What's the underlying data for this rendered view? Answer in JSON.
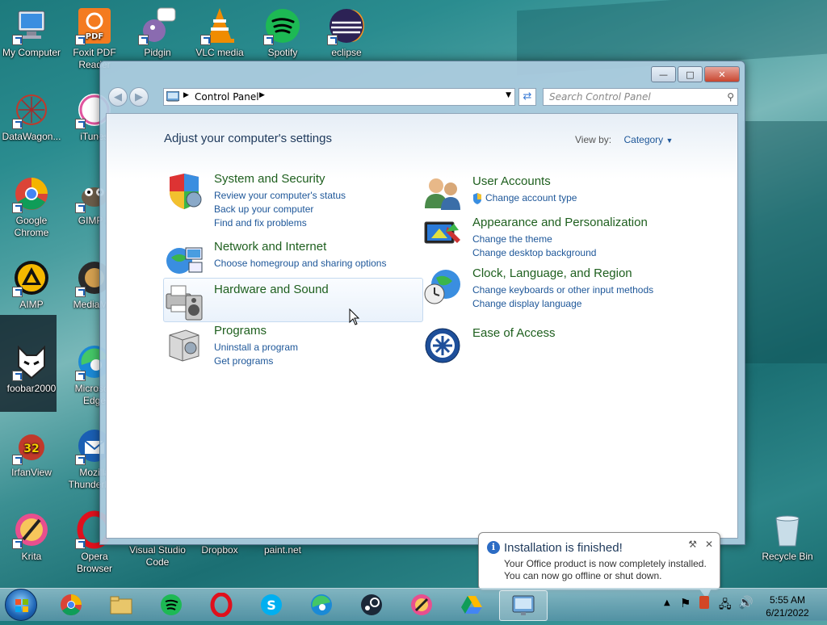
{
  "desktop": {
    "icons": [
      {
        "label": "My Computer",
        "name": "my-computer"
      },
      {
        "label": "Foxit PDF Reader",
        "name": "foxit-pdf"
      },
      {
        "label": "Pidgin",
        "name": "pidgin"
      },
      {
        "label": "VLC media",
        "name": "vlc"
      },
      {
        "label": "Spotify",
        "name": "spotify"
      },
      {
        "label": "eclipse",
        "name": "eclipse"
      },
      {
        "label": "DataWagon...",
        "name": "datawagon"
      },
      {
        "label": "iTunes",
        "name": "itunes"
      },
      {
        "label": "Google Chrome",
        "name": "chrome"
      },
      {
        "label": "GIMP 2",
        "name": "gimp"
      },
      {
        "label": "AIMP",
        "name": "aimp"
      },
      {
        "label": "MediaM...",
        "name": "mediamonkey"
      },
      {
        "label": "foobar2000",
        "name": "foobar2000"
      },
      {
        "label": "Microsoft Edge",
        "name": "edge"
      },
      {
        "label": "IrfanView",
        "name": "irfanview"
      },
      {
        "label": "Mozilla Thunderbird",
        "name": "thunderbird"
      },
      {
        "label": "Krita",
        "name": "krita"
      },
      {
        "label": "Opera Browser",
        "name": "opera"
      },
      {
        "label": "Visual Studio Code",
        "name": "vscode"
      },
      {
        "label": "Dropbox",
        "name": "dropbox"
      },
      {
        "label": "paint.net",
        "name": "paintnet"
      },
      {
        "label": "Recycle Bin",
        "name": "recycle-bin"
      }
    ]
  },
  "window": {
    "breadcrumb": "Control Panel",
    "search_placeholder": "Search Control Panel",
    "heading": "Adjust your computer's settings",
    "view_by_label": "View by:",
    "view_by_value": "Category",
    "categories": {
      "system_security": {
        "title": "System and Security",
        "links": [
          "Review your computer's status",
          "Back up your computer",
          "Find and fix problems"
        ]
      },
      "network": {
        "title": "Network and Internet",
        "links": [
          "Choose homegroup and sharing options"
        ]
      },
      "hardware": {
        "title": "Hardware and Sound"
      },
      "programs": {
        "title": "Programs",
        "links": [
          "Uninstall a program",
          "Get programs"
        ]
      },
      "user_accounts": {
        "title": "User Accounts",
        "links": [
          "Change account type"
        ]
      },
      "appearance": {
        "title": "Appearance and Personalization",
        "links": [
          "Change the theme",
          "Change desktop background"
        ]
      },
      "clock": {
        "title": "Clock, Language, and Region",
        "links": [
          "Change keyboards or other input methods",
          "Change display language"
        ]
      },
      "ease": {
        "title": "Ease of Access"
      }
    }
  },
  "notification": {
    "title": "Installation is finished!",
    "line1": "Your Office product is now completely installed.",
    "line2": "You can now go offline or shut down."
  },
  "taskbar": {
    "time": "5:55 AM",
    "date": "6/21/2022"
  }
}
